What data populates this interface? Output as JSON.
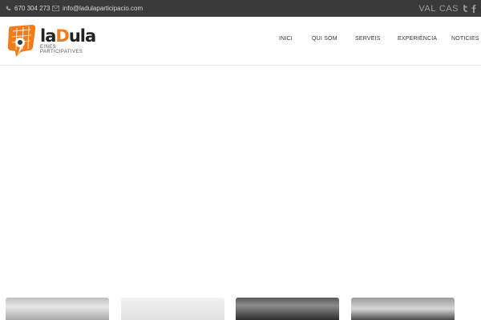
{
  "topbar": {
    "phone": "670 304 273",
    "email": "info@ladulaparticipacio.com",
    "languages": [
      "VAL",
      "CAS"
    ],
    "social": [
      "twitter-icon",
      "facebook-icon"
    ]
  },
  "logo": {
    "word_prefix": "la",
    "word_accent": "D",
    "word_suffix": "ula",
    "tagline": "EINES PARTICIPATIVES"
  },
  "nav": {
    "items": [
      "INICI",
      "QUI SOM",
      "SERVEIS",
      "EXPERIÈNCIA",
      "NOTICIES"
    ]
  },
  "colors": {
    "topbar_bg": "#3a3a3a",
    "brand_orange": "#f07c1b",
    "text_dark": "#333333"
  }
}
